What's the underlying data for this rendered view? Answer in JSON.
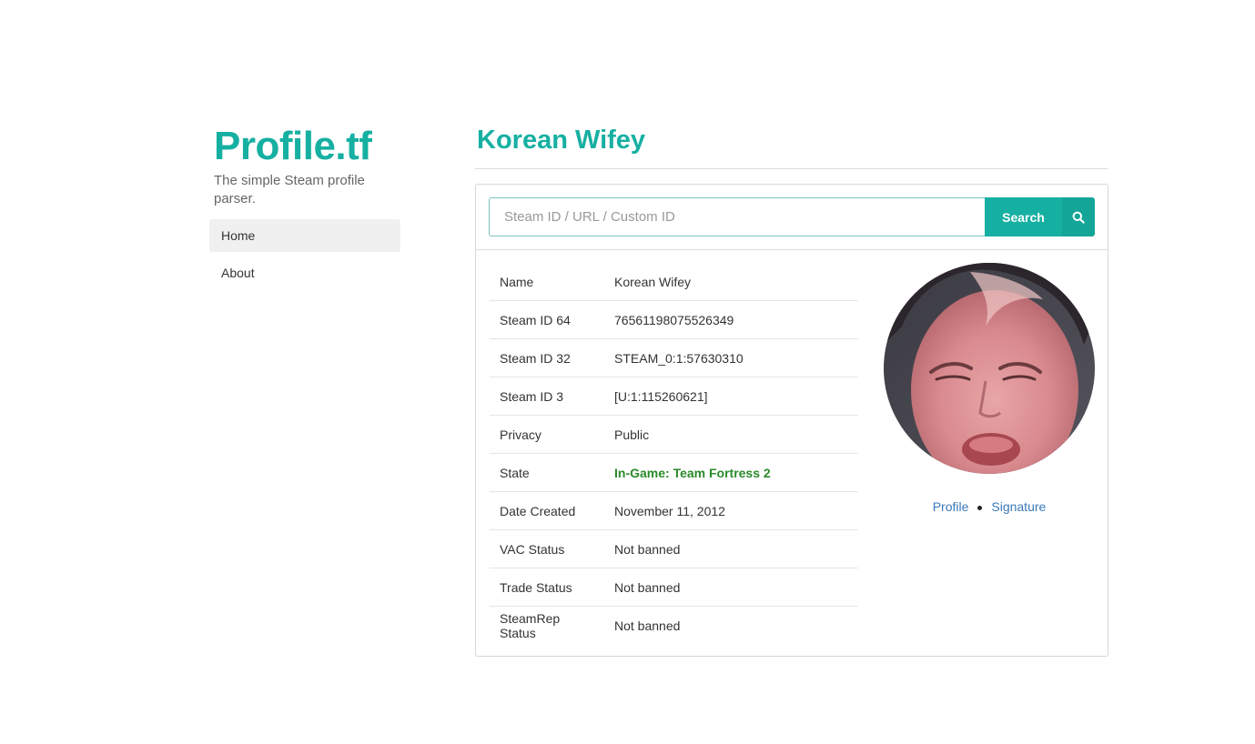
{
  "sidebar": {
    "brand": "Profile.tf",
    "tagline": "The simple Steam profile parser.",
    "nav": [
      {
        "label": "Home"
      },
      {
        "label": "About"
      }
    ]
  },
  "main": {
    "title": "Korean Wifey",
    "search": {
      "placeholder": "Steam ID / URL / Custom ID",
      "value": "",
      "button_label": "Search",
      "icon": "search-icon"
    },
    "profile": {
      "rows": [
        {
          "key": "Name",
          "value": "Korean Wifey"
        },
        {
          "key": "Steam ID 64",
          "value": "76561198075526349"
        },
        {
          "key": "Steam ID 32",
          "value": "STEAM_0:1:57630310"
        },
        {
          "key": "Steam ID 3",
          "value": "[U:1:115260621]"
        },
        {
          "key": "Privacy",
          "value": "Public"
        },
        {
          "key": "State",
          "value": "In-Game: Team Fortress 2"
        },
        {
          "key": "Date Created",
          "value": "November 11, 2012"
        },
        {
          "key": "VAC Status",
          "value": "Not banned"
        },
        {
          "key": "Trade Status",
          "value": "Not banned"
        },
        {
          "key": "SteamRep Status",
          "value": "Not banned"
        }
      ],
      "links": {
        "profile": "Profile",
        "signature": "Signature"
      }
    }
  },
  "colors": {
    "accent": "#16b0a2",
    "state_ingame": "#2a8a2a",
    "link": "#3a79b8"
  }
}
